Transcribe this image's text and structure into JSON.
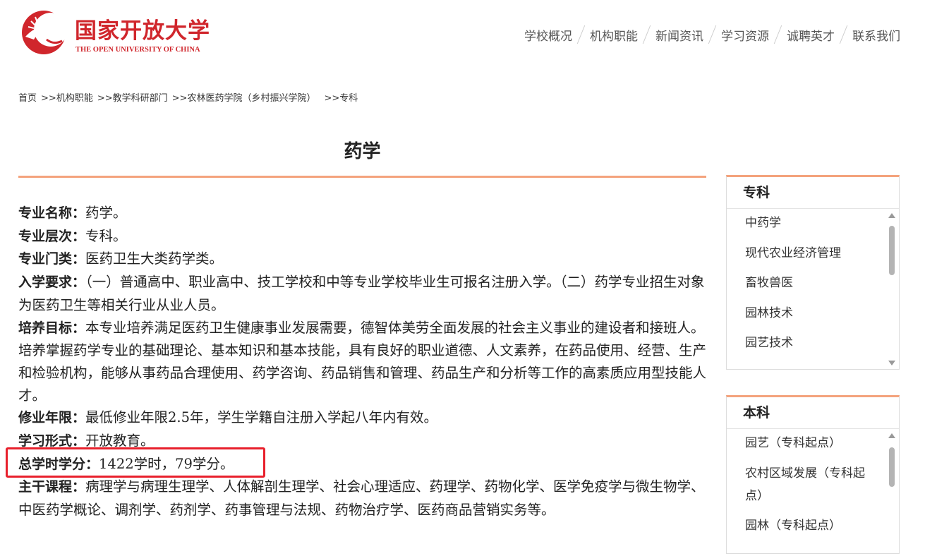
{
  "header": {
    "logo_cn": "国家开放大学",
    "logo_en": "THE OPEN UNIVERSITY OF CHINA",
    "nav": [
      "学校概况",
      "机构职能",
      "新闻资讯",
      "学习资源",
      "诚聘英才",
      "联系我们"
    ]
  },
  "breadcrumb": {
    "items": [
      "首页",
      "机构职能",
      "教学科研部门",
      "农林医药学院（乡村振兴学院）",
      "专科"
    ],
    "separator": ">>"
  },
  "page_title": "药学",
  "content": {
    "fields": [
      {
        "label": "专业名称：",
        "value": "药学。"
      },
      {
        "label": "专业层次：",
        "value": "专科。"
      },
      {
        "label": "专业门类：",
        "value": "医药卫生大类药学类。"
      },
      {
        "label": "入学要求：",
        "value": "（一）普通高中、职业高中、技工学校和中等专业学校毕业生可报名注册入学。（二）药学专业招生对象为医药卫生等相关行业从业人员。"
      },
      {
        "label": "培养目标：",
        "value": "本专业培养满足医药卫生健康事业发展需要，德智体美劳全面发展的社会主义事业的建设者和接班人。培养掌握药学专业的基础理论、基本知识和基本技能，具有良好的职业道德、人文素养，在药品使用、经营、生产和检验机构，能够从事药品合理使用、药学咨询、药品销售和管理、药品生产和分析等工作的高素质应用型技能人才。"
      },
      {
        "label": "修业年限：",
        "value": "最低修业年限2.5年，学生学籍自注册入学起八年内有效。"
      },
      {
        "label": "学习形式：",
        "value": "开放教育。"
      },
      {
        "label": "总学时学分：",
        "value": "1422学时，79学分。"
      },
      {
        "label": "主干课程：",
        "value": "病理学与病理生理学、人体解剖生理学、社会心理适应、药理学、药物化学、医学免疫学与微生物学、中医药学概论、调剂学、药剂学、药事管理与法规、药物治疗学、医药商品营销实务等。"
      }
    ]
  },
  "sidebar": {
    "zhuanke": {
      "title": "专科",
      "items": [
        "中药学",
        "现代农业经济管理",
        "畜牧兽医",
        "园林技术",
        "园艺技术"
      ]
    },
    "benke": {
      "title": "本科",
      "items": [
        "园艺（专科起点）",
        "农村区域发展（专科起点）",
        "园林（专科起点）"
      ]
    }
  },
  "colors": {
    "brand_red": "#d0262c",
    "accent_orange": "#f4a37d",
    "highlight_red": "#e8202c"
  }
}
